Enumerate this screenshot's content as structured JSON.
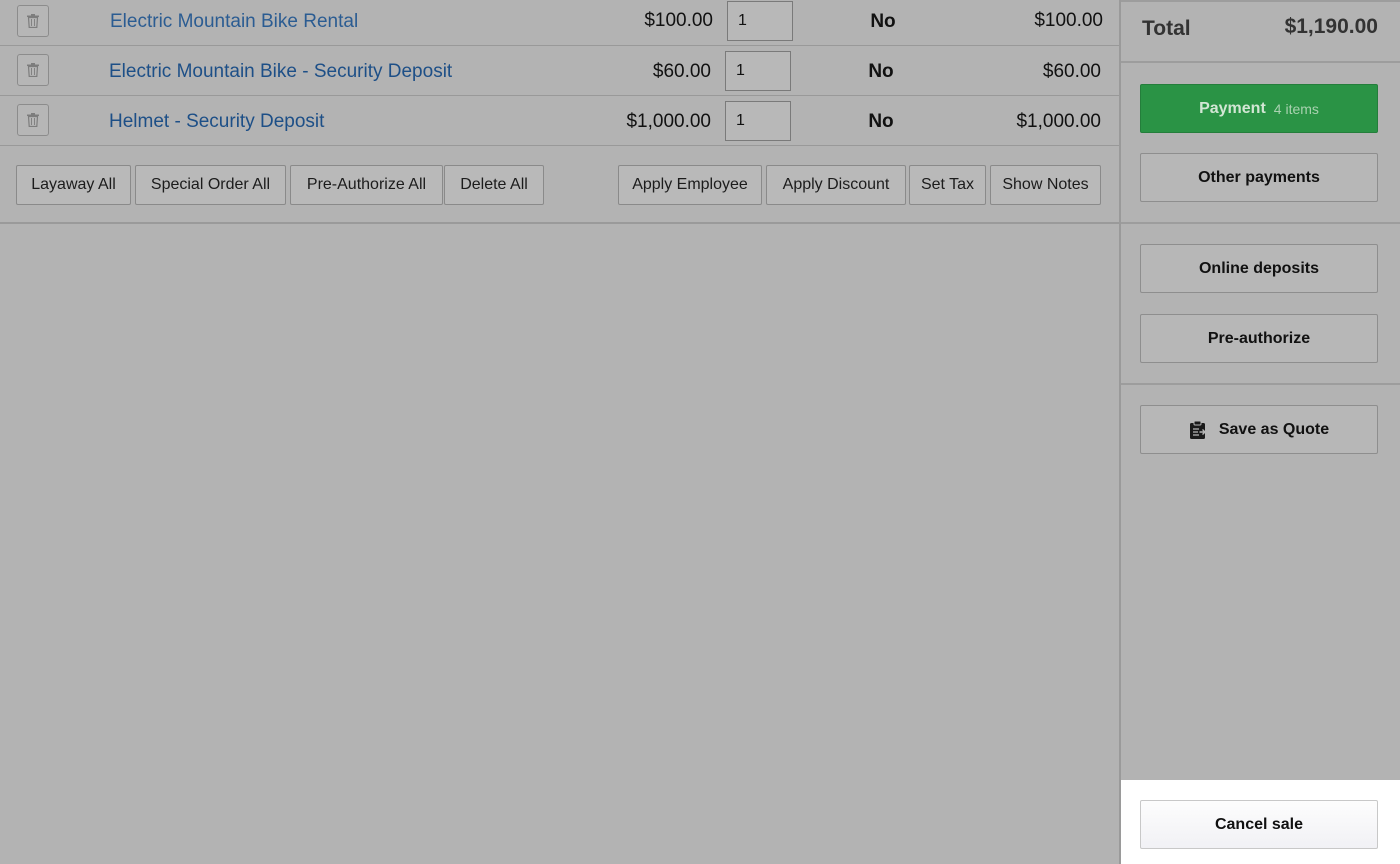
{
  "line_items": [
    {
      "name": "Electric Mountain Bike Rental",
      "price": "$100.00",
      "qty": "1",
      "taxed": "No",
      "total": "$100.00"
    },
    {
      "name": "Electric Mountain Bike - Security Deposit",
      "price": "$60.00",
      "qty": "1",
      "taxed": "No",
      "total": "$60.00"
    },
    {
      "name": "Helmet - Security Deposit",
      "price": "$1,000.00",
      "qty": "1",
      "taxed": "No",
      "total": "$1,000.00"
    }
  ],
  "bulk_actions": {
    "layaway_all": "Layaway All",
    "special_order_all": "Special Order All",
    "pre_authorize_all": "Pre-Authorize All",
    "delete_all": "Delete All",
    "apply_employee": "Apply Employee",
    "apply_discount": "Apply Discount",
    "set_tax": "Set Tax",
    "show_notes": "Show Notes"
  },
  "sidebar": {
    "total_label": "Total",
    "total_value": "$1,190.00",
    "payment_label": "Payment",
    "payment_count": "4 items",
    "other_payments": "Other payments",
    "online_deposits": "Online deposits",
    "pre_authorize": "Pre-authorize",
    "save_as_quote": "Save as Quote",
    "cancel_sale": "Cancel sale"
  },
  "icons": {
    "delete_row": "trash-icon",
    "save_quote": "clipboard-arrow-icon"
  },
  "colors": {
    "payment_green": "#2a9345",
    "item_link_blue": "#1d4f87",
    "overlay_gray": "#b3b3b3"
  }
}
